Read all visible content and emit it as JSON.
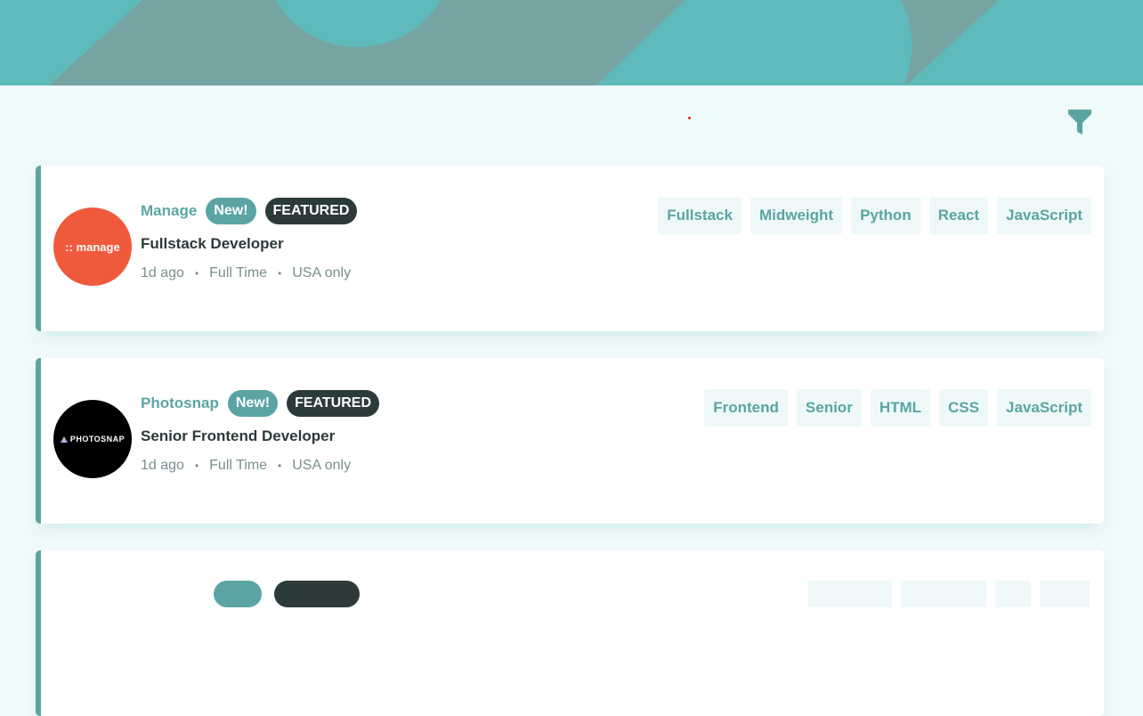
{
  "filter": {
    "icon": "filter-icon"
  },
  "jobs": [
    {
      "company": "Manage",
      "logo_text": ":: manage",
      "logo_color": "#f05a3c",
      "new_label": "New!",
      "featured_label": "FEATURED",
      "position": "Fullstack Developer",
      "posted": "1d ago",
      "contract": "Full Time",
      "location": "USA only",
      "tags": [
        "Fullstack",
        "Midweight",
        "Python",
        "React",
        "JavaScript"
      ]
    },
    {
      "company": "Photosnap",
      "logo_text": "PHOTOSNAP",
      "logo_color": "#000000",
      "new_label": "New!",
      "featured_label": "FEATURED",
      "position": "Senior Frontend Developer",
      "posted": "1d ago",
      "contract": "Full Time",
      "location": "USA only",
      "tags": [
        "Frontend",
        "Senior",
        "HTML",
        "CSS",
        "JavaScript"
      ]
    }
  ],
  "colors": {
    "primary": "#5ba4a4",
    "dark": "#2c3a3a",
    "header": "#5fbabb",
    "background": "#effafa"
  }
}
